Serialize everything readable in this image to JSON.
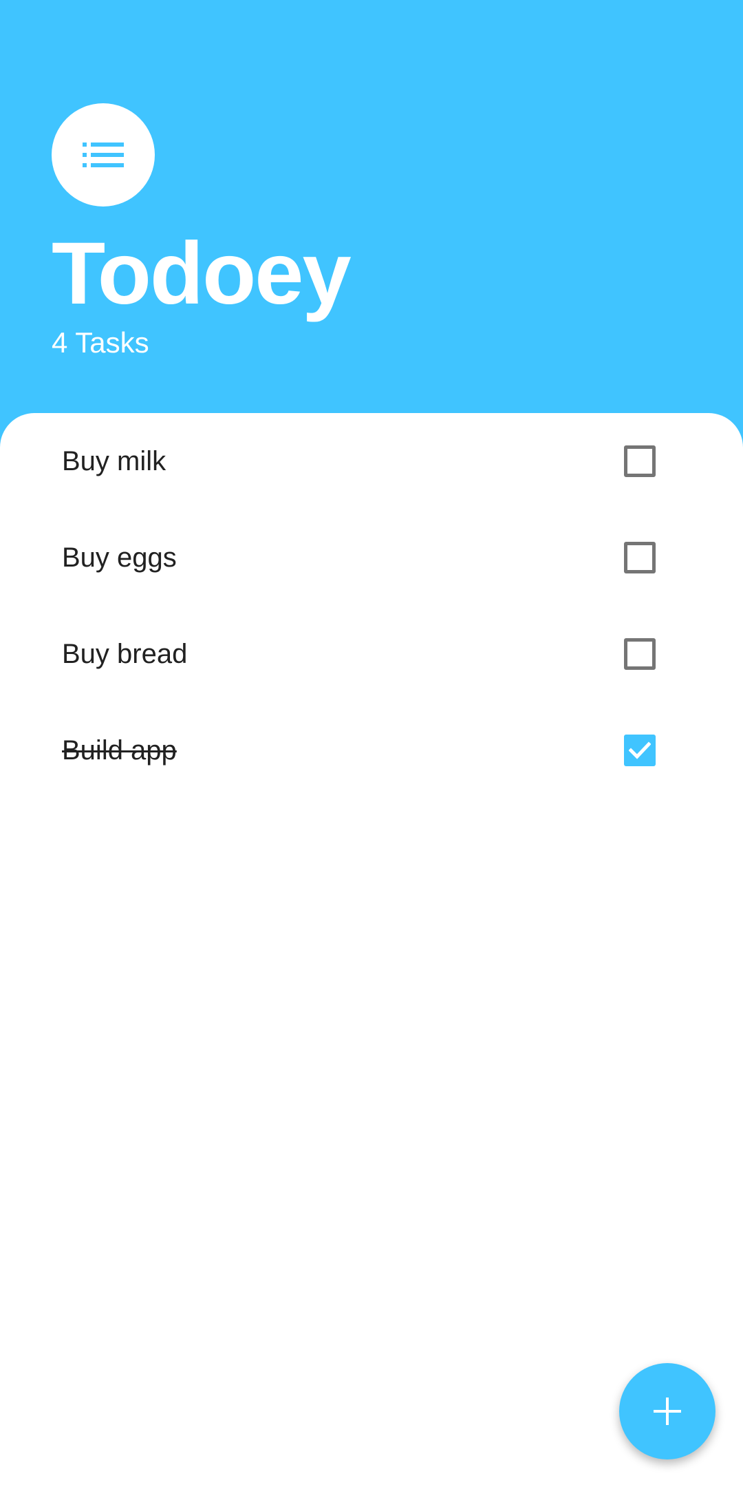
{
  "header": {
    "title": "Todoey",
    "task_count": "4 Tasks",
    "icon": "list-icon"
  },
  "tasks": [
    {
      "label": "Buy milk",
      "done": false
    },
    {
      "label": "Buy eggs",
      "done": false
    },
    {
      "label": "Buy bread",
      "done": false
    },
    {
      "label": "Build app",
      "done": true
    }
  ],
  "fab": {
    "icon": "plus-icon"
  },
  "colors": {
    "accent": "#40C4FF",
    "background": "#FFFFFF",
    "text": "#212121",
    "checkbox_unchecked": "#757575"
  }
}
